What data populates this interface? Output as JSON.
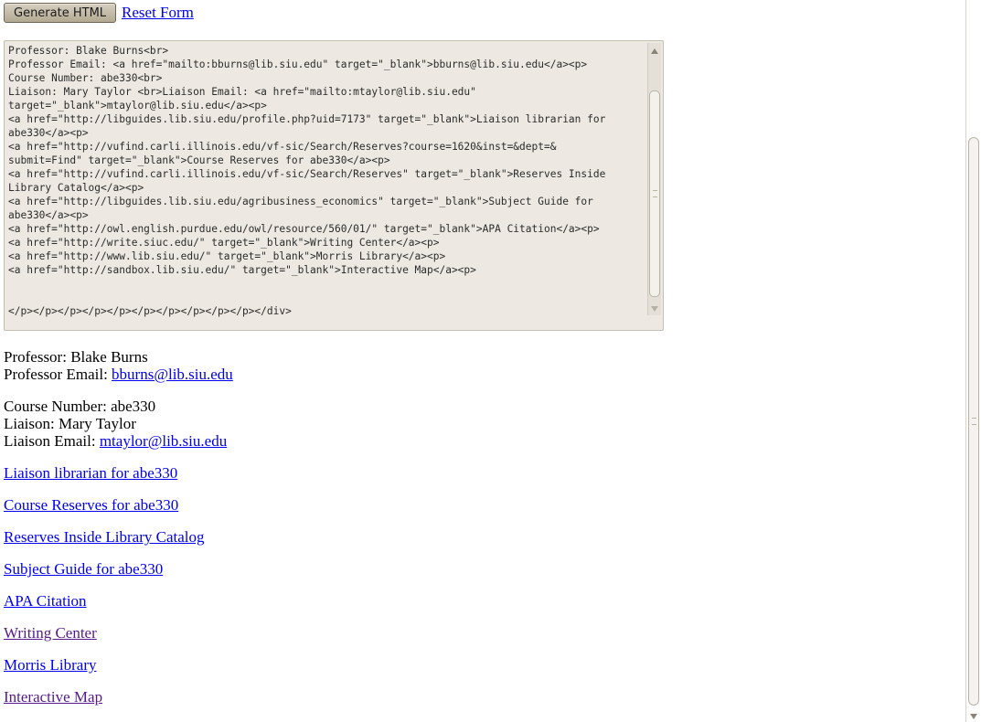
{
  "toolbar": {
    "generate_label": "Generate HTML",
    "reset_label": "Reset Form"
  },
  "code_box": {
    "lines": [
      "Professor: Blake Burns<br>",
      "Professor Email: <a href=\"mailto:bburns@lib.siu.edu\" target=\"_blank\">bburns@lib.siu.edu</a><p>",
      "Course Number: abe330<br>",
      "Liaison: Mary Taylor <br>Liaison Email: <a href=\"mailto:mtaylor@lib.siu.edu\"",
      "target=\"_blank\">mtaylor@lib.siu.edu</a><p>",
      "<a href=\"http://libguides.lib.siu.edu/profile.php?uid=7173\" target=\"_blank\">Liaison librarian for",
      "abe330</a><p>",
      "<a href=\"http://vufind.carli.illinois.edu/vf-sic/Search/Reserves?course=1620&inst=&dept=&",
      "submit=Find\" target=\"_blank\">Course Reserves for abe330</a><p>",
      "<a href=\"http://vufind.carli.illinois.edu/vf-sic/Search/Reserves\" target=\"_blank\">Reserves Inside",
      "Library Catalog</a><p>",
      "<a href=\"http://libguides.lib.siu.edu/agribusiness_economics\" target=\"_blank\">Subject Guide for",
      "abe330</a><p>",
      "<a href=\"http://owl.english.purdue.edu/owl/resource/560/01/\" target=\"_blank\">APA Citation</a><p>",
      "<a href=\"http://write.siuc.edu/\" target=\"_blank\">Writing Center</a><p>",
      "<a href=\"http://www.lib.siu.edu/\" target=\"_blank\">Morris Library</a><p>",
      "<a href=\"http://sandbox.lib.siu.edu/\" target=\"_blank\">Interactive Map</a><p>",
      "",
      "",
      "</p></p></p></p></p></p></p></p></p></p></div>"
    ]
  },
  "output": {
    "professor_label": "Professor: Blake Burns",
    "professor_email_label": "Professor Email: ",
    "professor_email": "bburns@lib.siu.edu",
    "course_number": "Course Number: abe330",
    "liaison": "Liaison: Mary Taylor",
    "liaison_email_label": "Liaison Email: ",
    "liaison_email": "mtaylor@lib.siu.edu",
    "links": [
      {
        "label": "Liaison librarian for abe330",
        "visited": false
      },
      {
        "label": "Course Reserves for abe330",
        "visited": false
      },
      {
        "label": "Reserves Inside Library Catalog",
        "visited": false
      },
      {
        "label": "Subject Guide for abe330",
        "visited": false
      },
      {
        "label": "APA Citation",
        "visited": false
      },
      {
        "label": "Writing Center",
        "visited": true
      },
      {
        "label": "Morris Library",
        "visited": false
      },
      {
        "label": "Interactive Map",
        "visited": true
      }
    ]
  },
  "colors": {
    "link": "#0000ee",
    "visited_link": "#551a8b",
    "code_background": "#ede9e2"
  }
}
